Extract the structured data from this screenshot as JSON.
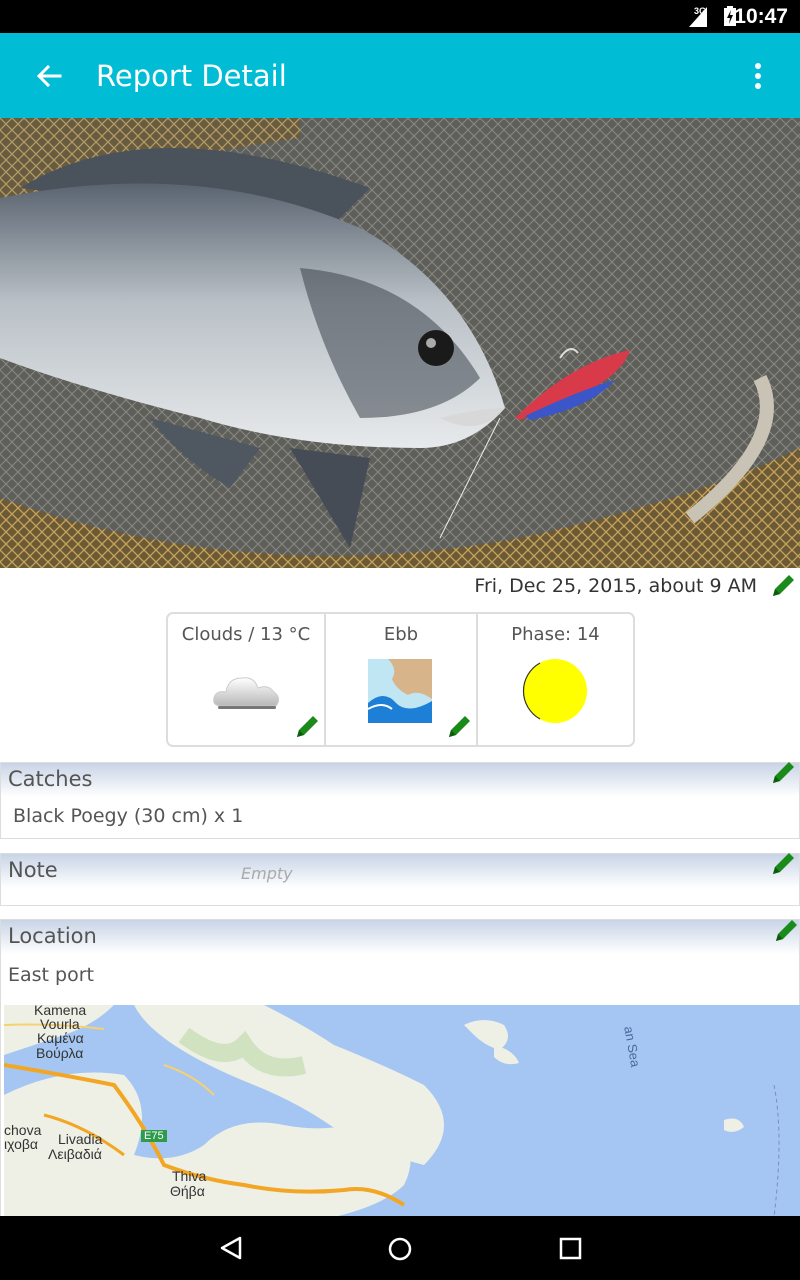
{
  "status_bar": {
    "network": "3G",
    "time": "10:47"
  },
  "app_bar": {
    "title": "Report Detail"
  },
  "report": {
    "date": "Fri, Dec 25, 2015, about 9 AM"
  },
  "conditions": {
    "weather": {
      "label": "Clouds / 13 °C",
      "icon": "cloud-icon"
    },
    "tide": {
      "label": "Ebb",
      "icon": "tide-icon"
    },
    "moon": {
      "label": "Phase: 14",
      "icon": "moon-icon",
      "color": "#ffff00"
    }
  },
  "catches": {
    "title": "Catches",
    "value": "Black Poegy (30 cm) x 1"
  },
  "note": {
    "title": "Note",
    "placeholder": "Empty"
  },
  "location": {
    "title": "Location",
    "value": "East port",
    "map_labels": {
      "kamena": "Kamena",
      "vourla": "Vourla",
      "vourla_gr": "Καμένα",
      "vourla_gr2": "Βούρλα",
      "chova": "chova",
      "chova_gr": "ιχοβα",
      "livadia": "Livadia",
      "livadia_gr": "Λειβαδιά",
      "thiva": "Thiva",
      "thiva_gr": "Θήβα",
      "road": "E75",
      "sea": "an Sea"
    }
  },
  "colors": {
    "app_bar": "#00bcd4",
    "edit_icon": "#1a8a1a",
    "moon": "#ffff00"
  }
}
